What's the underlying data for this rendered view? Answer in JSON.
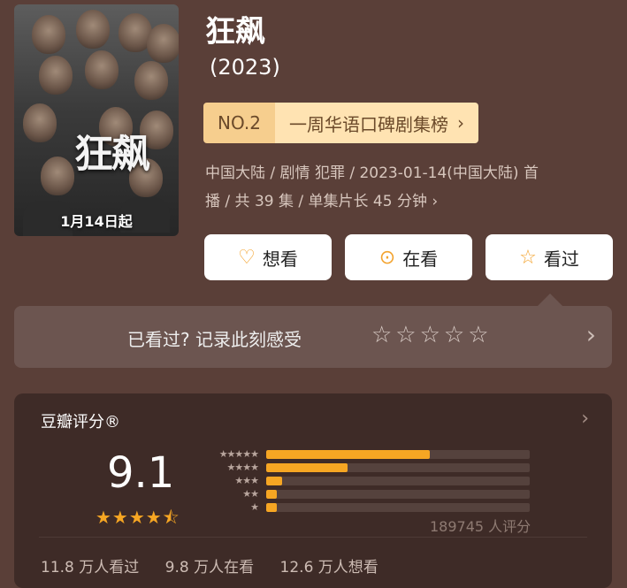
{
  "poster": {
    "title_text": "狂飙",
    "date_text": "1月14日起"
  },
  "title": "狂飙",
  "year": "(2023)",
  "rank": {
    "no": "NO.2",
    "name": "一周华语口碑剧集榜",
    "arrow": "›"
  },
  "meta": {
    "line1": "中国大陆 / 剧情 犯罪 / 2023-01-14(中国大陆) 首",
    "line2": "播 / 共 39 集 / 单集片长 45 分钟 ›"
  },
  "buttons": [
    {
      "label": "想看",
      "icon": "heart-plus-icon"
    },
    {
      "label": "在看",
      "icon": "circle-dot-icon"
    },
    {
      "label": "看过",
      "icon": "star-outline-icon"
    }
  ],
  "record": {
    "text": "已看过? 记录此刻感受",
    "stars": "☆☆☆☆☆",
    "arrow": "›"
  },
  "rating": {
    "label": "豆瓣评分®",
    "score": "9.1",
    "stars_display": "★★★★⯪",
    "distribution": [
      {
        "stars": "★★★★★",
        "fraction": 0.62
      },
      {
        "stars": "★★★★",
        "fraction": 0.31
      },
      {
        "stars": "★★★",
        "fraction": 0.06
      },
      {
        "stars": "★★",
        "fraction": 0.04
      },
      {
        "stars": "★",
        "fraction": 0.04
      }
    ],
    "votes": "189745 人评分",
    "counts": {
      "watched": "11.8 万人看过",
      "watching": "9.8 万人在看",
      "want": "12.6 万人想看"
    }
  },
  "colors": {
    "accent": "#f6a623",
    "background": "#5a3f38",
    "card": "#3e2b27"
  }
}
